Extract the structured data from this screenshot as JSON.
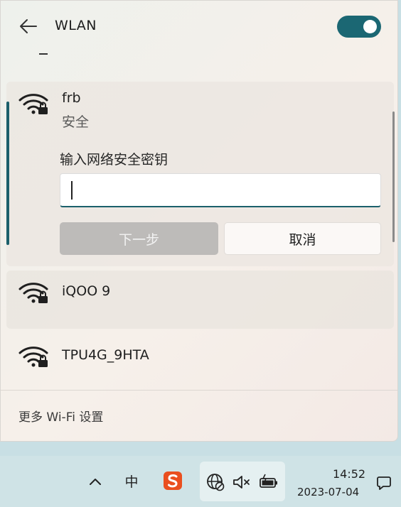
{
  "header": {
    "title": "WLAN",
    "toggle_on": true
  },
  "networks": [
    {
      "name": "frb",
      "status": "安全",
      "expanded": true,
      "key_label": "输入网络安全密钥",
      "key_value": "",
      "next_label": "下一步",
      "cancel_label": "取消"
    },
    {
      "name": "iQOO 9"
    },
    {
      "name": "TPU4G_9HTA"
    }
  ],
  "footer": {
    "more_settings": "更多 Wi-Fi 设置"
  },
  "taskbar": {
    "ime_label": "中",
    "time": "14:52",
    "date": "2023-07-04"
  },
  "colors": {
    "accent": "#1b6773",
    "taskbar": "#cfe3e6",
    "sogou": "#ea4f1f"
  },
  "icons": {
    "back": "arrow-left-icon",
    "wifi": "wifi-secured-icon",
    "chevron": "chevron-up-icon",
    "sogou": "sogou-ime-icon",
    "network": "globe-blocked-icon",
    "volume": "volume-muted-icon",
    "battery": "battery-charging-icon",
    "notifications": "notification-icon"
  }
}
